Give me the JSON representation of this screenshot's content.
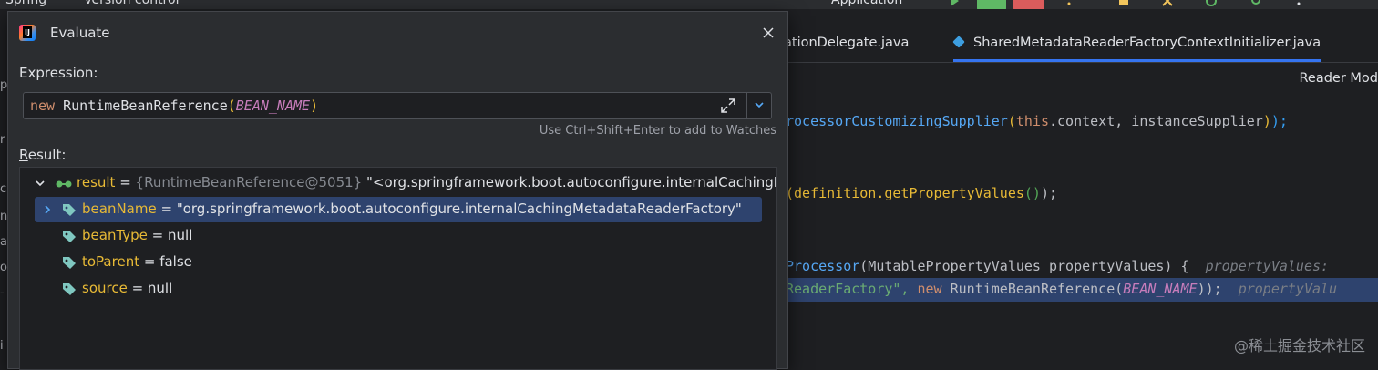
{
  "topbar": {
    "menu_left": "Spring",
    "menu_vcs": "Version control",
    "run_config": "Application"
  },
  "editor": {
    "tabs": [
      {
        "label": "ationDelegate.java"
      },
      {
        "label": "SharedMetadataReaderFactoryContextInitializer.java"
      }
    ],
    "reader_mode": "Reader Mod",
    "code_lines": {
      "l1_a": "rocessorCustomizingSupplier",
      "l1_b": "(",
      "l1_c": "this",
      "l1_d": ".context, instanceSupplier",
      "l1_e": ")",
      "l1_f": ");",
      "l2_a": "(definition.getPropertyValues",
      "l2_b": "()",
      "l2_c": ");",
      "l3_a": "Processor",
      "l3_b": "(MutablePropertyValues propertyValues) {",
      "l3_hint": "propertyValues:",
      "l4_a": "ReaderFactory\", ",
      "l4_b": "new ",
      "l4_c": "RuntimeBeanReference(",
      "l4_d": "BEAN_NAME",
      "l4_e": "));",
      "l4_hint": "propertyValu"
    },
    "watermark": "@稀土掘金技术社区"
  },
  "dialog": {
    "title": "Evaluate",
    "expression_label": "Expression:",
    "expression": {
      "kw": "new",
      "cls": " RuntimeBeanReference",
      "open": "(",
      "arg": "BEAN_NAME",
      "close": ")"
    },
    "watches_hint": "Use Ctrl+Shift+Enter to add to Watches",
    "result_label_first": "R",
    "result_label_rest": "esult:",
    "tree": {
      "root": {
        "name": "result",
        "eq": " = ",
        "ref": "{RuntimeBeanReference@5051}",
        "value": " \"<org.springframework.boot.autoconfigure.internalCachingMet"
      },
      "children": [
        {
          "name": "beanName",
          "eq": " = ",
          "value": "\"org.springframework.boot.autoconfigure.internalCachingMetadataReaderFactory\""
        },
        {
          "name": "beanType",
          "eq": " = ",
          "value": "null"
        },
        {
          "name": "toParent",
          "eq": " = ",
          "value": "false"
        },
        {
          "name": "source",
          "eq": " = ",
          "value": "null"
        }
      ]
    }
  },
  "gutter_chars": [
    "p",
    "r",
    "c",
    "n",
    "a",
    "o",
    "-",
    "i"
  ],
  "colors": {
    "selection": "#2e436e",
    "accent": "#3574f0",
    "field_name": "#e8ba36",
    "tag_icon": "#7fc7c0"
  }
}
